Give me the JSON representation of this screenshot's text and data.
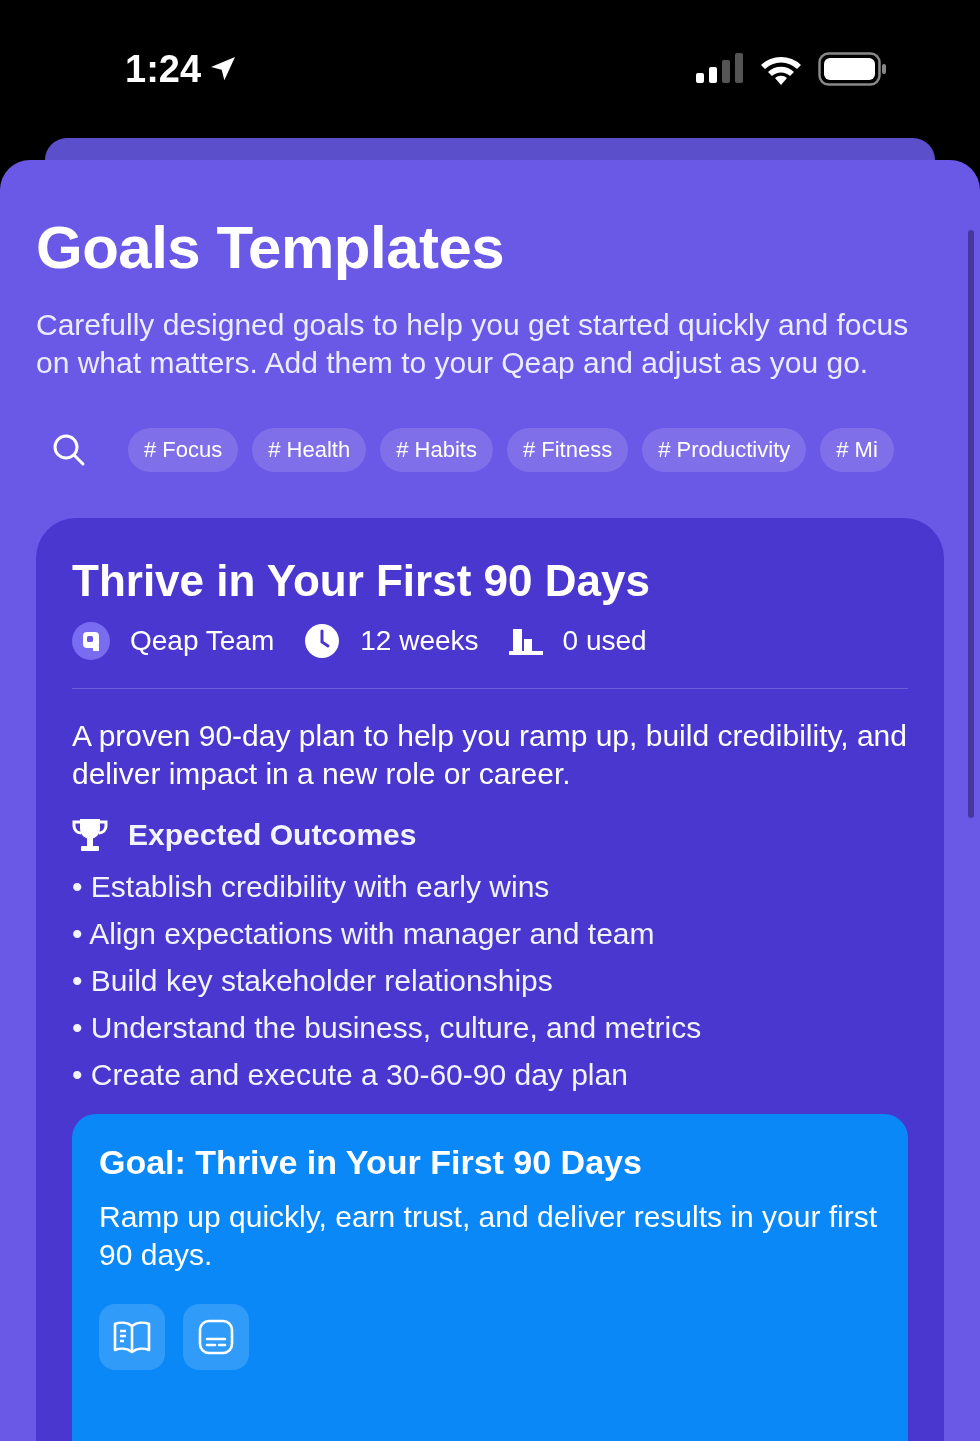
{
  "status_bar": {
    "time": "1:24"
  },
  "header": {
    "title": "Goals Templates",
    "subtitle": "Carefully designed goals to help you get started quickly and focus on what matters. Add them to your Qeap and adjust as you go."
  },
  "tags": [
    {
      "label": "# Focus"
    },
    {
      "label": "# Health"
    },
    {
      "label": "# Habits"
    },
    {
      "label": "# Fitness"
    },
    {
      "label": "# Productivity"
    },
    {
      "label": "# Mi"
    }
  ],
  "template": {
    "title": "Thrive in Your First 90 Days",
    "author": "Qeap Team",
    "duration": "12 weeks",
    "usage": "0 used",
    "description": "A proven 90-day plan to help you ramp up, build credibility, and deliver impact in a new role or career.",
    "outcomes_title": "Expected Outcomes",
    "outcomes": [
      "• Establish credibility with early wins",
      "• Align expectations with manager and team",
      "• Build key stakeholder relationships",
      "• Understand the business, culture, and metrics",
      "• Create and execute a 30-60-90 day plan"
    ],
    "goal": {
      "title": "Goal: Thrive in Your First 90 Days",
      "description": "Ramp up quickly, earn trust, and deliver results in your first 90 days.",
      "actions": [
        {
          "kind": "book"
        },
        {
          "kind": "captions"
        }
      ]
    }
  }
}
